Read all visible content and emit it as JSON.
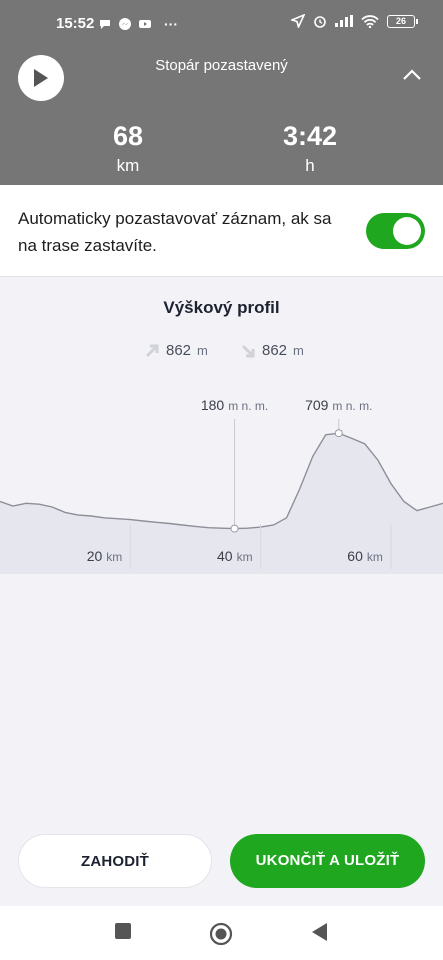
{
  "status_bar": {
    "time": "15:52",
    "battery": "26",
    "more": "···"
  },
  "header": {
    "title": "Stopár pozastavený",
    "distance_value": "68",
    "distance_unit": "km",
    "time_value": "3:42",
    "time_unit": "h"
  },
  "auto_pause": {
    "label": "Automaticky pozastavovať záznam, ak sa na trase zastavíte.",
    "enabled": true
  },
  "profile": {
    "title": "Výškový profil",
    "ascent_value": "862",
    "ascent_unit": "m",
    "descent_value": "862",
    "descent_unit": "m",
    "marker_low_value": "180",
    "marker_low_unit": "m n. m.",
    "marker_high_value": "709",
    "marker_high_unit": "m n. m.",
    "ticks": [
      {
        "value": "20",
        "unit": "km"
      },
      {
        "value": "40",
        "unit": "km"
      },
      {
        "value": "60",
        "unit": "km"
      }
    ]
  },
  "chart_data": {
    "type": "area",
    "title": "Výškový profil",
    "xlabel": "",
    "ylabel": "",
    "x_unit": "km",
    "x_ticks": [
      20,
      40,
      60
    ],
    "x": [
      0,
      2,
      4,
      6,
      8,
      10,
      12,
      14,
      16,
      18,
      20,
      22,
      24,
      26,
      28,
      30,
      32,
      34,
      36,
      38,
      40,
      42,
      44,
      46,
      48,
      50,
      52,
      54,
      56,
      58,
      60,
      62,
      64,
      66,
      68
    ],
    "y": [
      330,
      305,
      320,
      315,
      300,
      270,
      255,
      250,
      240,
      235,
      230,
      222,
      215,
      208,
      200,
      192,
      185,
      182,
      180,
      182,
      188,
      200,
      240,
      400,
      580,
      700,
      709,
      680,
      650,
      560,
      430,
      330,
      280,
      300,
      320
    ],
    "annotations": [
      {
        "label": "180 m n. m.",
        "x": 36,
        "y": 180
      },
      {
        "label": "709 m n. m.",
        "x": 52,
        "y": 709
      }
    ]
  },
  "actions": {
    "discard_label": "ZAHODIŤ",
    "save_label": "UKONČIŤ A ULOŽIŤ"
  },
  "colors": {
    "accent_green": "#1fa81f",
    "header_gray": "#767676"
  },
  "icons": {
    "play": "play-icon",
    "collapse": "chevron-up-icon",
    "ascent": "arrow-up-right-icon",
    "descent": "arrow-down-right-icon"
  }
}
